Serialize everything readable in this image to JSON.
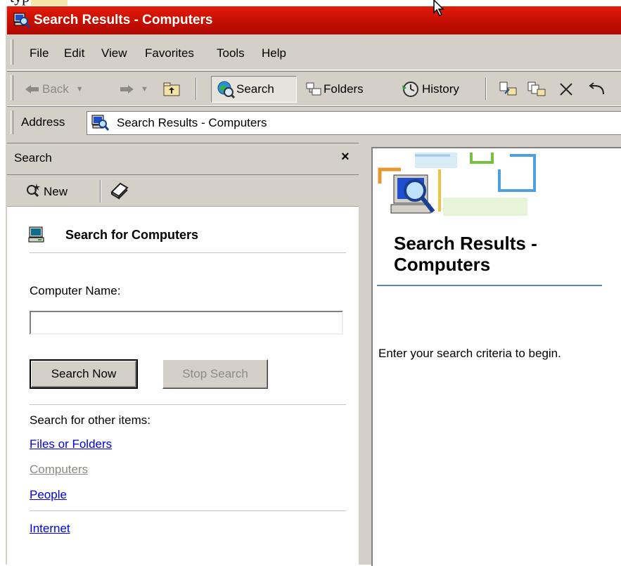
{
  "document_fragment": "typ",
  "window": {
    "title": "Search Results - Computers"
  },
  "menu": {
    "items": [
      "File",
      "Edit",
      "View",
      "Favorites",
      "Tools",
      "Help"
    ]
  },
  "toolbar": {
    "back_label": "Back",
    "search_label": "Search",
    "folders_label": "Folders",
    "history_label": "History"
  },
  "address": {
    "label": "Address",
    "value": "Search Results - Computers"
  },
  "search_pane": {
    "title": "Search",
    "close_glyph": "×",
    "new_label": "New",
    "heading": "Search for Computers",
    "computer_name_label": "Computer Name:",
    "computer_name_value": "",
    "search_now_label": "Search Now",
    "stop_search_label": "Stop Search",
    "other_items_label": "Search for other items:",
    "links": {
      "files": "Files or Folders",
      "computers": "Computers",
      "people": "People",
      "internet": "Internet"
    }
  },
  "results_pane": {
    "title": "Search Results - Computers",
    "hint": "Enter your search criteria to begin."
  },
  "colors": {
    "titlebar": "#c40e02",
    "face": "#d4d0c8",
    "link": "#0000ee",
    "disabled": "#8c8a84",
    "accent_rule": "#5b84c4"
  }
}
